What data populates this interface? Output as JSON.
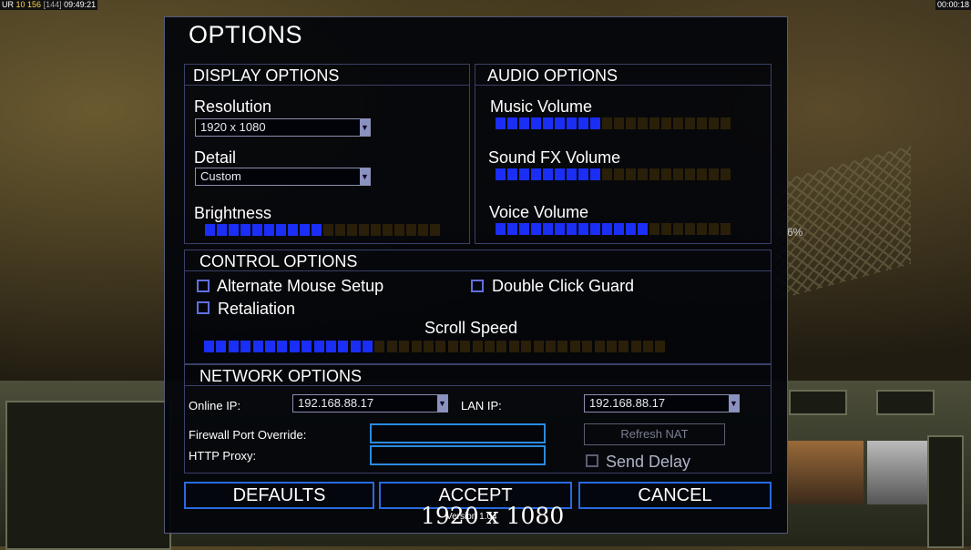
{
  "hud": {
    "left_prefix": "UR",
    "left_a": "10",
    "left_b": "156",
    "left_c": "[144]",
    "left_time": "09:49:21",
    "right_time": "00:00:18"
  },
  "background": {
    "pct_text": "6%"
  },
  "dialog": {
    "title": "OPTIONS",
    "display": {
      "heading": "DISPLAY OPTIONS",
      "resolution_label": "Resolution",
      "resolution_value": "1920 x 1080",
      "detail_label": "Detail",
      "detail_value": "Custom",
      "brightness_label": "Brightness",
      "brightness_level": 0.5
    },
    "audio": {
      "heading": "AUDIO OPTIONS",
      "music_label": "Music Volume",
      "music_level": 0.44,
      "sfx_label": "Sound FX Volume",
      "sfx_level": 0.44,
      "voice_label": "Voice Volume",
      "voice_level": 0.63
    },
    "control": {
      "heading": "CONTROL OPTIONS",
      "alt_mouse_label": "Alternate Mouse Setup",
      "double_click_label": "Double Click Guard",
      "retaliation_label": "Retaliation",
      "scroll_label": "Scroll Speed",
      "scroll_level": 0.37
    },
    "network": {
      "heading": "NETWORK OPTIONS",
      "online_ip_label": "Online IP:",
      "online_ip_value": "192.168.88.17",
      "lan_ip_label": "LAN IP:",
      "lan_ip_value": "192.168.88.17",
      "firewall_label": "Firewall Port Override:",
      "http_proxy_label": "HTTP Proxy:",
      "refresh_nat_label": "Refresh NAT",
      "send_delay_label": "Send Delay"
    },
    "buttons": {
      "defaults": "DEFAULTS",
      "accept": "ACCEPT",
      "cancel": "CANCEL"
    },
    "version": "Version 1.04"
  },
  "overlay_resolution": "1920 x 1080",
  "colors": {
    "slider_on": "#1a2ef5",
    "slider_off": "#2a1f08",
    "button_border": "#2a6ae0"
  }
}
